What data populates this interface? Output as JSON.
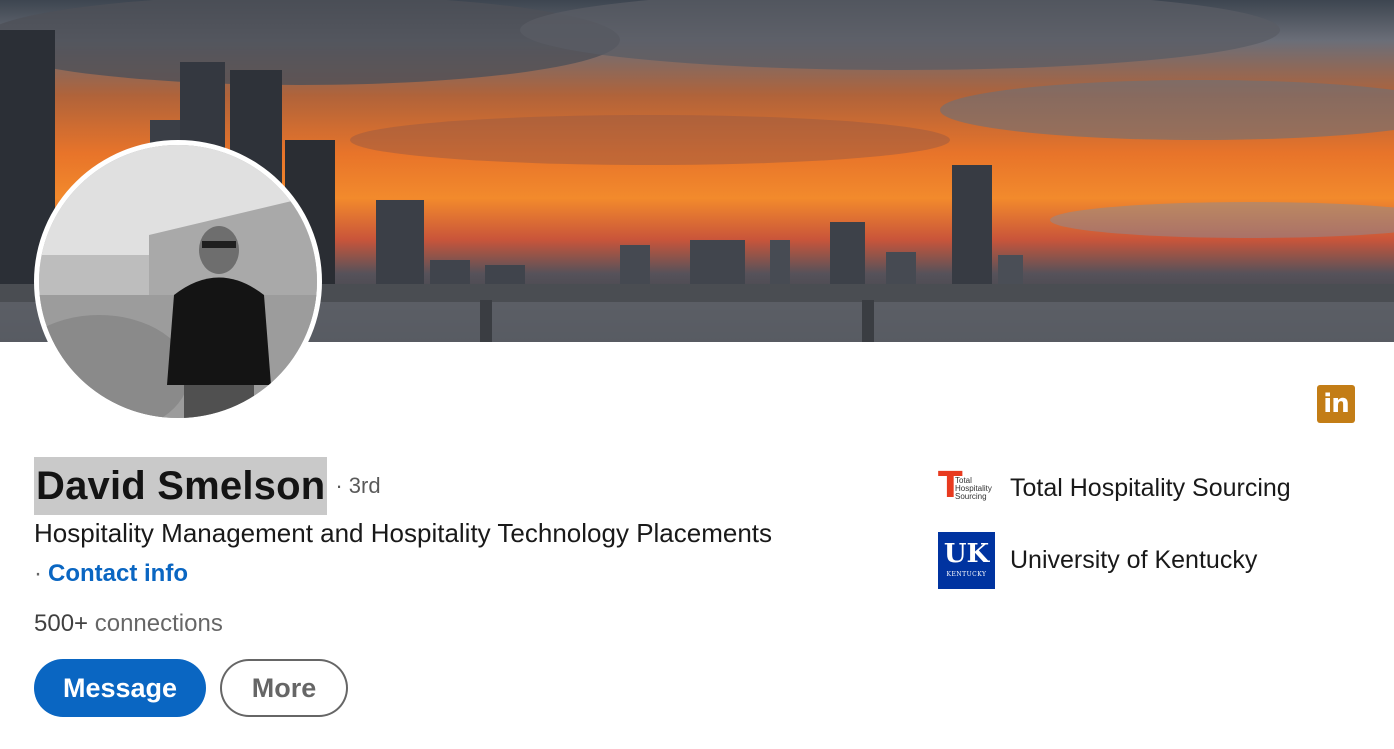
{
  "banner": {
    "image_desc": "city skyline sunset"
  },
  "profile": {
    "name": "David Smelson",
    "degree": "· 3rd",
    "headline": "Hospitality Management and Hospitality Technology Placements",
    "contact_prefix": "·",
    "contact_label": "Contact info",
    "connections_count": "500+",
    "connections_label": "connections"
  },
  "actions": {
    "message_label": "Message",
    "more_label": "More"
  },
  "orgs": [
    {
      "name": "Total Hospitality Sourcing",
      "logo_letter": "T",
      "logo_text": "Total Hospitality Sourcing"
    },
    {
      "name": "University of Kentucky",
      "logo_mark": "UK",
      "logo_text": "KENTUCKY"
    }
  ],
  "badge": {
    "text": "in"
  },
  "colors": {
    "accent": "#0a66c2",
    "linkedin_badge": "#c37d16",
    "uk_blue": "#0033a0",
    "ths_red": "#e83a1f"
  }
}
